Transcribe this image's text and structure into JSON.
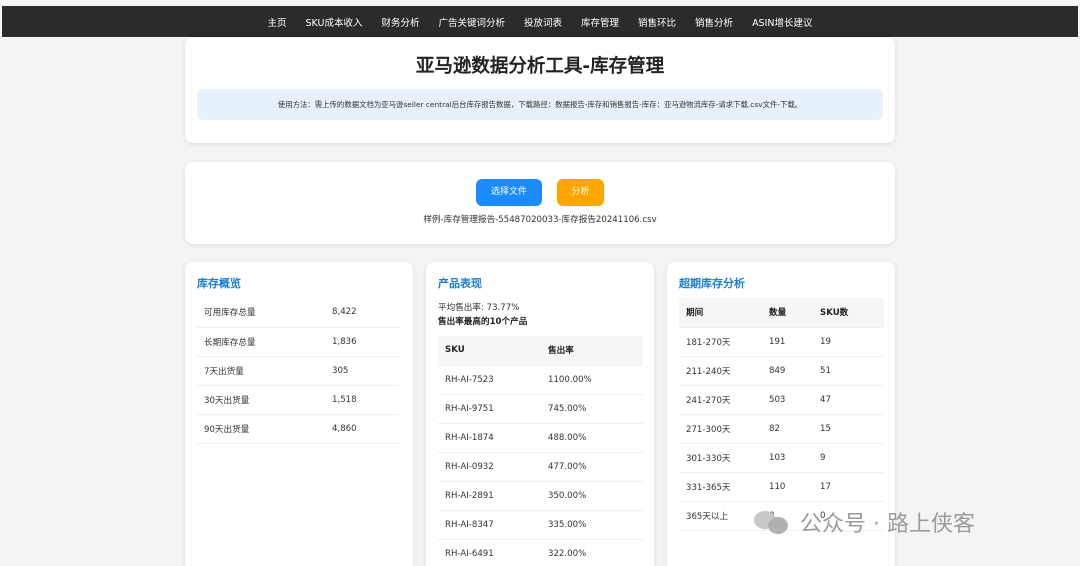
{
  "nav": [
    "主页",
    "SKU成本收入",
    "财务分析",
    "广告关键词分析",
    "投放词表",
    "库存管理",
    "销售环比",
    "销售分析",
    "ASIN增长建议"
  ],
  "header": {
    "title": "亚马逊数据分析工具-库存管理",
    "usage": "使用方法：需上传的数据文档为亚马逊seller central后台库存报告数据，下载路径：数据报告-库存和销售报告-库存：亚马逊物流库存-请求下载.csv文件-下载。"
  },
  "upload": {
    "choose_label": "选择文件",
    "analyze_label": "分析",
    "filename": "样例-库存管理报告-55487020033-库存报告20241106.csv"
  },
  "inventory": {
    "title": "库存概览",
    "rows": [
      {
        "label": "可用库存总量",
        "value": "8,422"
      },
      {
        "label": "长期库存总量",
        "value": "1,836"
      },
      {
        "label": "7天出货量",
        "value": "305"
      },
      {
        "label": "30天出货量",
        "value": "1,518"
      },
      {
        "label": "90天出货量",
        "value": "4,860"
      }
    ]
  },
  "product": {
    "title": "产品表现",
    "avg_sell_rate": "平均售出率: 73.77%",
    "top10_title": "售出率最高的10个产品",
    "columns": [
      "SKU",
      "售出率"
    ],
    "rows": [
      {
        "sku": "RH-AI-7523",
        "rate": "1100.00%"
      },
      {
        "sku": "RH-AI-9751",
        "rate": "745.00%"
      },
      {
        "sku": "RH-AI-1874",
        "rate": "488.00%"
      },
      {
        "sku": "RH-AI-0932",
        "rate": "477.00%"
      },
      {
        "sku": "RH-AI-2891",
        "rate": "350.00%"
      },
      {
        "sku": "RH-AI-8347",
        "rate": "335.00%"
      },
      {
        "sku": "RH-AI-6491",
        "rate": "322.00%"
      }
    ]
  },
  "aged": {
    "title": "超期库存分析",
    "columns": [
      "期间",
      "数量",
      "SKU数"
    ],
    "rows": [
      {
        "period": "181-270天",
        "qty": "191",
        "skus": "19"
      },
      {
        "period": "211-240天",
        "qty": "849",
        "skus": "51"
      },
      {
        "period": "241-270天",
        "qty": "503",
        "skus": "47"
      },
      {
        "period": "271-300天",
        "qty": "82",
        "skus": "15"
      },
      {
        "period": "301-330天",
        "qty": "103",
        "skus": "9"
      },
      {
        "period": "331-365天",
        "qty": "110",
        "skus": "17"
      },
      {
        "period": "365天以上",
        "qty": "0",
        "skus": "0"
      }
    ]
  },
  "watermark": {
    "icon": "wechat-icon",
    "text": "公众号 · 路上侠客"
  }
}
